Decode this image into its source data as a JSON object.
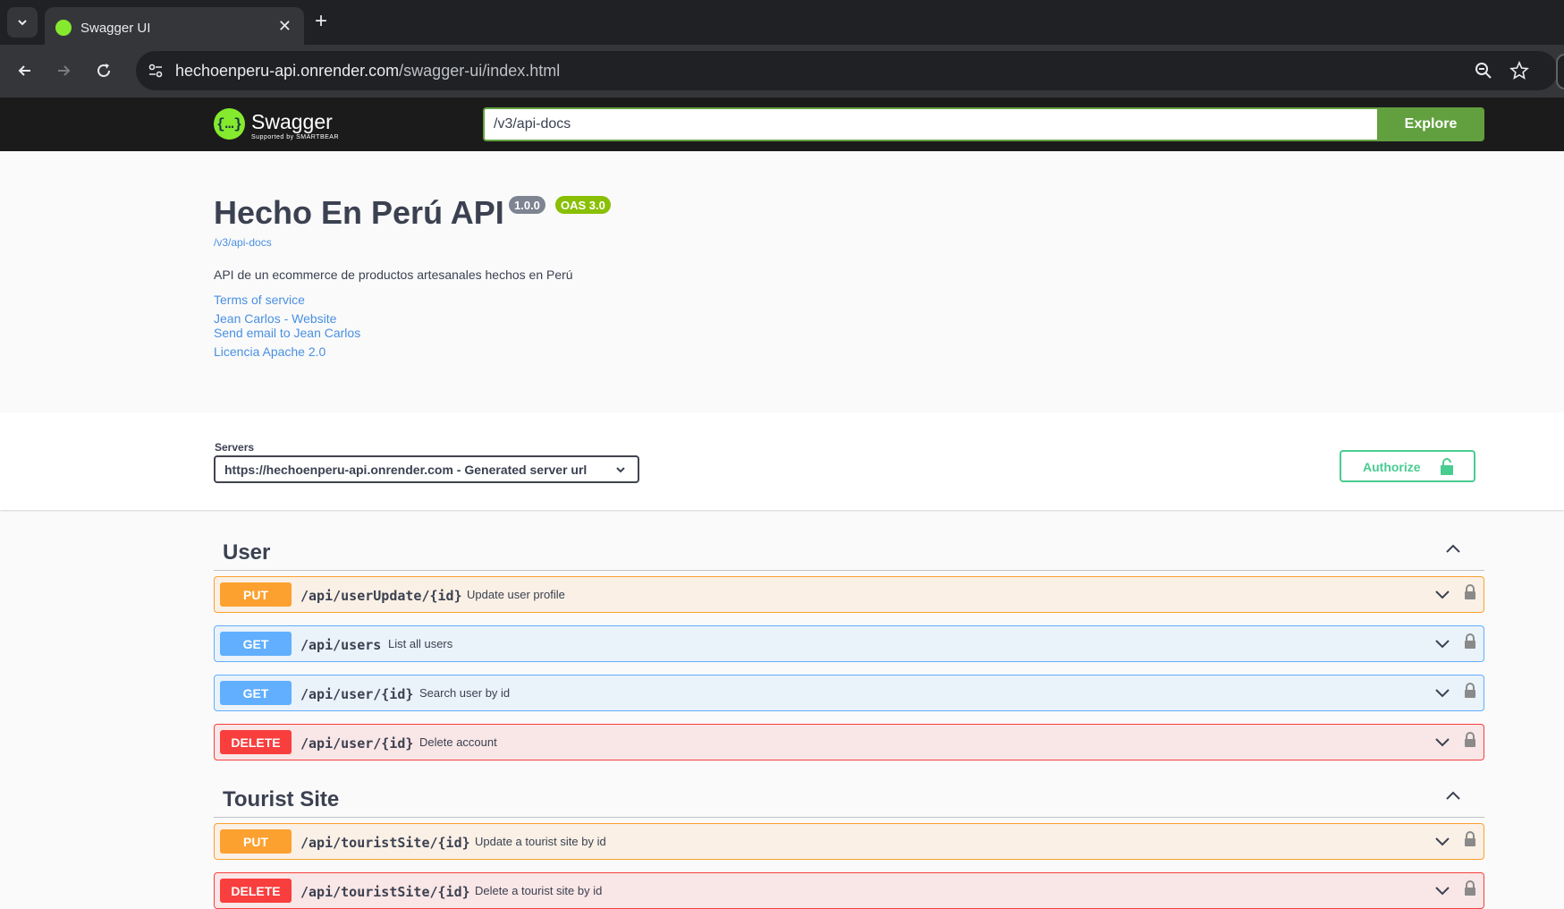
{
  "browser": {
    "tab_title": "Swagger UI",
    "url_host": "hechoenperu-api.onrender.com",
    "url_path": "/swagger-ui/index.html"
  },
  "topbar": {
    "logo_text": "Swagger",
    "logo_sub": "Supported by SMARTBEAR",
    "spec_url_value": "/v3/api-docs",
    "explore_label": "Explore"
  },
  "info": {
    "title": "Hecho En Perú API",
    "version": "1.0.0",
    "oas": "OAS 3.0",
    "spec_link": "/v3/api-docs",
    "description": "API de un ecommerce de productos artesanales hechos en Perú",
    "terms": "Terms of service",
    "contact_website": "Jean Carlos - Website",
    "contact_email": "Send email to Jean Carlos",
    "license": "Licencia Apache 2.0"
  },
  "servers": {
    "label": "Servers",
    "selected": "https://hechoenperu-api.onrender.com - Generated server url",
    "authorize_label": "Authorize"
  },
  "tags": [
    {
      "name": "User",
      "operations": [
        {
          "method": "PUT",
          "path": "/api/userUpdate/{id}",
          "summary": "Update user profile"
        },
        {
          "method": "GET",
          "path": "/api/users",
          "summary": "List all users"
        },
        {
          "method": "GET",
          "path": "/api/user/{id}",
          "summary": "Search user by id"
        },
        {
          "method": "DELETE",
          "path": "/api/user/{id}",
          "summary": "Delete account"
        }
      ]
    },
    {
      "name": "Tourist Site",
      "operations": [
        {
          "method": "PUT",
          "path": "/api/touristSite/{id}",
          "summary": "Update a tourist site by id"
        },
        {
          "method": "DELETE",
          "path": "/api/touristSite/{id}",
          "summary": "Delete a tourist site by id"
        }
      ]
    }
  ]
}
